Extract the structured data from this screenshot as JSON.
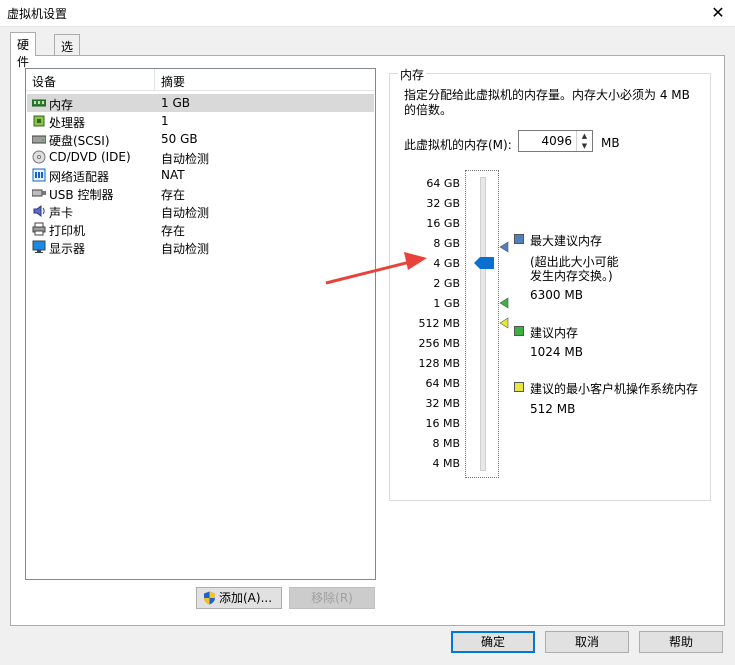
{
  "window": {
    "title": "虚拟机设置"
  },
  "tabs": [
    {
      "label": "硬件"
    },
    {
      "label": "选项"
    }
  ],
  "device_list": {
    "headers": {
      "device": "设备",
      "summary": "摘要"
    },
    "rows": [
      {
        "name": "内存",
        "value": "1 GB",
        "icon": "memory-icon"
      },
      {
        "name": "处理器",
        "value": "1",
        "icon": "processor-icon"
      },
      {
        "name": "硬盘(SCSI)",
        "value": "50 GB",
        "icon": "harddisk-icon"
      },
      {
        "name": "CD/DVD (IDE)",
        "value": "自动检测",
        "icon": "cd-dvd-icon"
      },
      {
        "name": "网络适配器",
        "value": "NAT",
        "icon": "network-icon"
      },
      {
        "name": "USB 控制器",
        "value": "存在",
        "icon": "usb-icon"
      },
      {
        "name": "声卡",
        "value": "自动检测",
        "icon": "sound-icon"
      },
      {
        "name": "打印机",
        "value": "存在",
        "icon": "printer-icon"
      },
      {
        "name": "显示器",
        "value": "自动检测",
        "icon": "display-icon"
      }
    ]
  },
  "buttons": {
    "add": "添加(A)...",
    "remove": "移除(R)",
    "ok": "确定",
    "cancel": "取消",
    "help": "帮助"
  },
  "memory": {
    "group_title": "内存",
    "description": "指定分配给此虚拟机的内存量。内存大小必须为 4 MB 的倍数。",
    "label": "此虚拟机的内存(M):",
    "value": "4096",
    "unit": "MB",
    "scale": [
      "64 GB",
      "32 GB",
      "16 GB",
      "8 GB",
      "4 GB",
      "2 GB",
      "1 GB",
      "512 MB",
      "256 MB",
      "128 MB",
      "64 MB",
      "32 MB",
      "16 MB",
      "8 MB",
      "4 MB"
    ],
    "legend": {
      "max": {
        "title": "最大建议内存",
        "note1": "(超出此大小可能",
        "note2": "发生内存交换。)",
        "value": "6300 MB"
      },
      "recommended": {
        "title": "建议内存",
        "value": "1024 MB"
      },
      "min": {
        "title": "建议的最小客户机操作系统内存",
        "value": "512 MB"
      }
    }
  },
  "colors": {
    "max_marker": "#4f81bd",
    "recommended_marker": "#3cb043",
    "min_marker": "#e8e83a",
    "thumb": "#0a6fd1",
    "arrow": "#e8423c"
  }
}
